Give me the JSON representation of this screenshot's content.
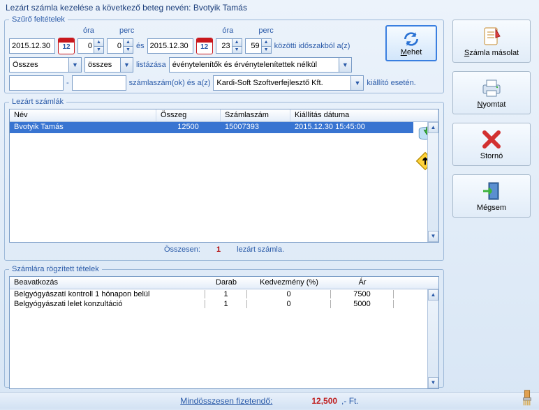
{
  "window": {
    "title": "Lezárt számla kezelése a következő beteg nevén: Bvotyik Tamás"
  },
  "filters": {
    "legend": "Szűrő feltételek",
    "date_from": "2015.12.30",
    "date_to": "2015.12.30",
    "hour_label": "óra",
    "min_label": "perc",
    "hour_from": "0",
    "min_from": "0",
    "hour_to": "23",
    "min_to": "59",
    "and": "és",
    "range_suffix": "közötti időszakból a(z)",
    "combo1": "Összes",
    "combo2": "összes",
    "list_label": "listázása",
    "valid_combo": "événytelenítők és érvénytelenítettek nélkül",
    "mehet": "Mehet",
    "inv_num_from": "",
    "inv_num_to": "",
    "inv_num_label": "számlaszám(ok) és a(z)",
    "issuer_combo": "Kardi-Soft Szoftverfejlesztő Kft.",
    "issuer_suffix": "kiállító esetén."
  },
  "closed": {
    "legend": "Lezárt számlák",
    "cols": {
      "name": "Név",
      "sum": "Összeg",
      "num": "Számlaszám",
      "date": "Kiállítás dátuma"
    },
    "row": {
      "name": "Bvotyik Tamás",
      "sum": "12500",
      "num": "15007393",
      "date": "2015.12.30 15:45:00"
    },
    "summary_label": "Összesen:",
    "summary_count": "1",
    "summary_suffix": "lezárt számla."
  },
  "items": {
    "legend": "Számlára rögzített tételek",
    "cols": {
      "name": "Beavatkozás",
      "qty": "Darab",
      "disc": "Kedvezmény (%)",
      "price": "Ár"
    },
    "rows": [
      {
        "name": "Belgyógyászatí kontroll 1 hónapon belül",
        "qty": "1",
        "disc": "0",
        "price": "7500"
      },
      {
        "name": "Belgyógyászati lelet konzultáció",
        "qty": "1",
        "disc": "0",
        "price": "5000"
      }
    ]
  },
  "footer": {
    "label": "Mindösszesen fizetendő:",
    "amount": "12,500",
    "unit": ",- Ft."
  },
  "rbtn": {
    "copy": "Számla másolat",
    "print": "Nyomtat",
    "storno": "Stornó",
    "cancel": "Mégsem"
  }
}
